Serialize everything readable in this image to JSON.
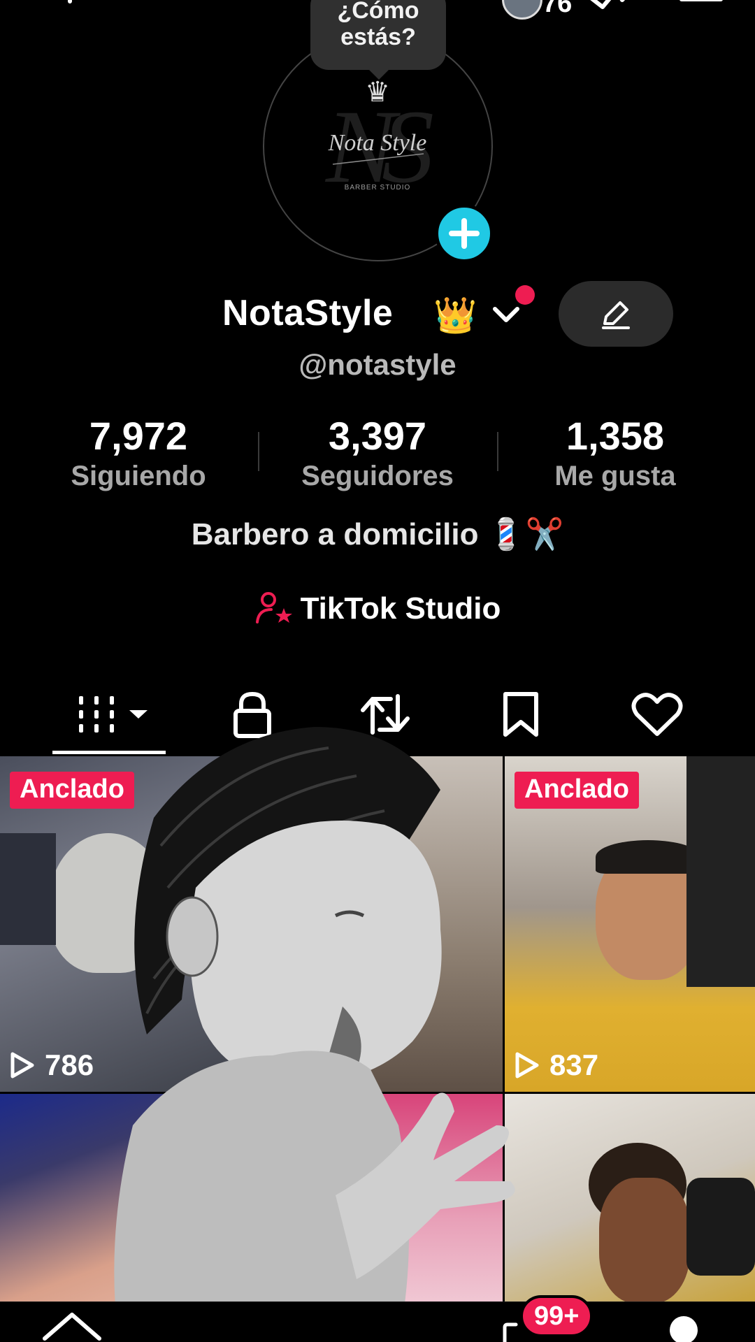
{
  "topbar": {
    "add_friend_icon": "add-friend-icon",
    "notification_count": "76",
    "activity_icon": "activity-icon",
    "menu_icon": "menu-icon"
  },
  "profile": {
    "speech_bubble": "¿Cómo estás?",
    "logo_text": "Nota Style",
    "logo_subtitle": "BARBER STUDIO",
    "name": "NotaStyle",
    "name_emoji": "👑",
    "handle": "@notastyle"
  },
  "stats": [
    {
      "value": "7,972",
      "label": "Siguiendo"
    },
    {
      "value": "3,397",
      "label": "Seguidores"
    },
    {
      "value": "1,358",
      "label": "Me gusta"
    }
  ],
  "bio": "Barbero a domicilio 💈✂️",
  "studio_link": "TikTok Studio",
  "tabs": [
    {
      "name": "videos",
      "icon": "grid-icon",
      "active": true
    },
    {
      "name": "private",
      "icon": "lock-icon",
      "active": false
    },
    {
      "name": "reposts",
      "icon": "repost-icon",
      "active": false
    },
    {
      "name": "favorites",
      "icon": "bookmark-icon",
      "active": false
    },
    {
      "name": "liked",
      "icon": "heart-icon",
      "active": false
    }
  ],
  "videos": [
    {
      "pinned_label": "Anclado",
      "views": "786"
    },
    {
      "pinned_label": "",
      "views": ""
    },
    {
      "pinned_label": "Anclado",
      "views": "837"
    },
    {
      "pinned_label": "",
      "views": ""
    },
    {
      "pinned_label": "",
      "views": ""
    },
    {
      "pinned_label": "",
      "views": ""
    }
  ],
  "bottom_nav": {
    "home_icon": "home-icon",
    "inbox_badge": "99+",
    "profile_icon": "profile-icon"
  },
  "colors": {
    "accent": "#ee1d52",
    "add_button": "#20c9e4",
    "background": "#000000"
  }
}
